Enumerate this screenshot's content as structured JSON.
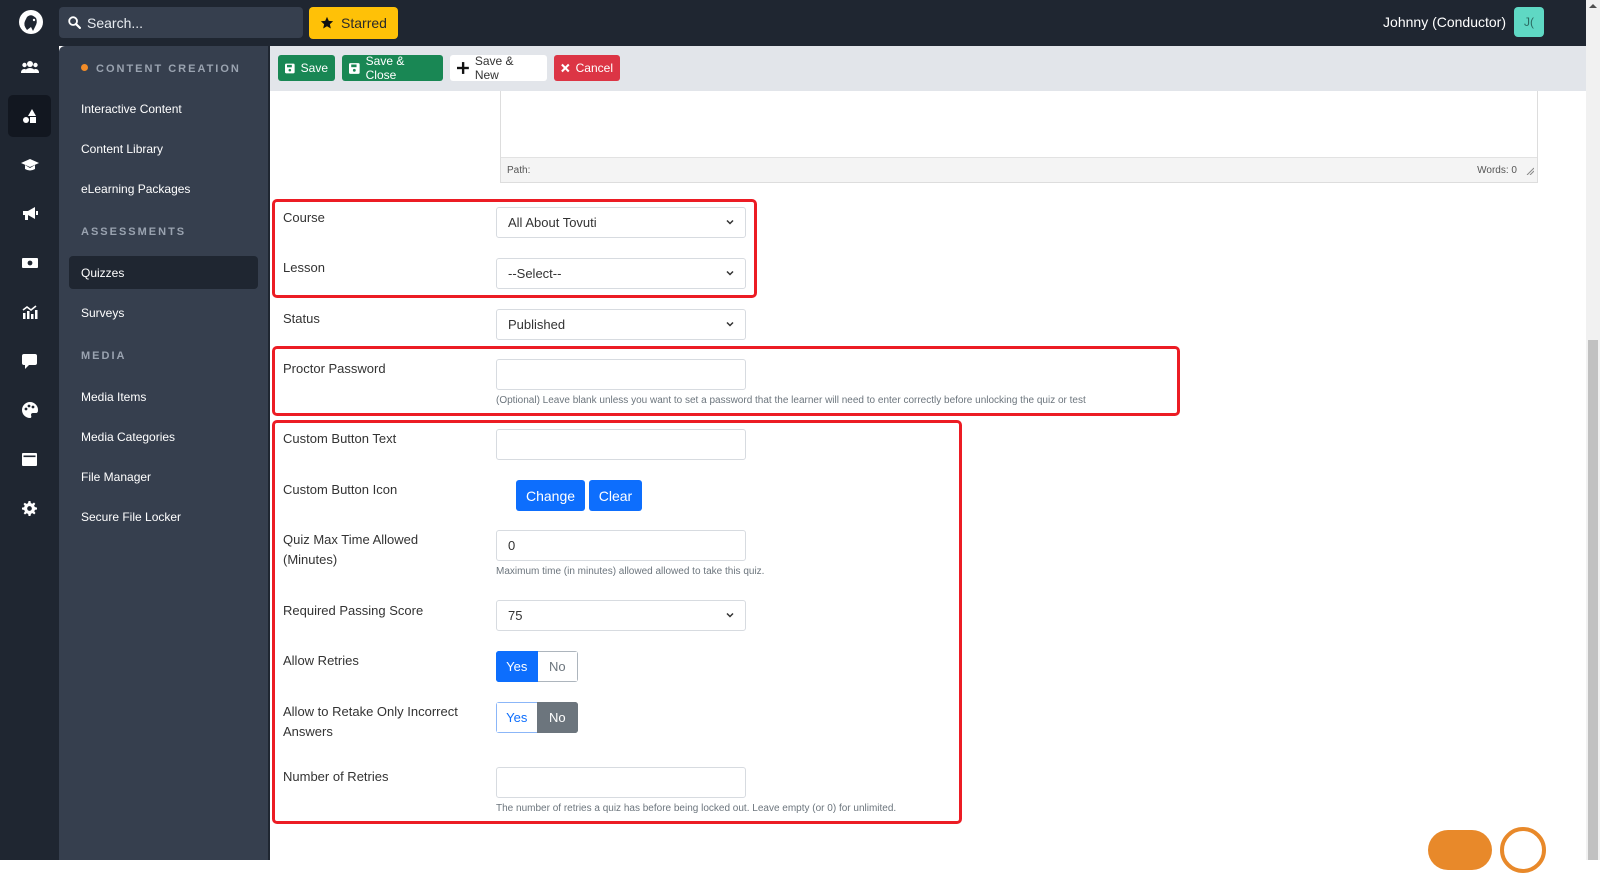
{
  "topbar": {
    "search_placeholder": "Search...",
    "starred_label": "Starred",
    "user_name": "Johnny (Conductor)",
    "avatar_initials": "J("
  },
  "rail": {
    "icons": [
      "users-icon",
      "shapes-icon",
      "graduation-cap-icon",
      "megaphone-icon",
      "money-icon",
      "chart-icon",
      "comment-icon",
      "palette-icon",
      "window-icon",
      "gear-icon"
    ],
    "active_index": 1
  },
  "sidenav": {
    "sections": [
      {
        "heading": "CONTENT CREATION",
        "items": [
          "Interactive Content",
          "Content Library",
          "eLearning Packages"
        ]
      },
      {
        "heading": "ASSESSMENTS",
        "items": [
          "Quizzes",
          "Surveys"
        ]
      },
      {
        "heading": "MEDIA",
        "items": [
          "Media Items",
          "Media Categories",
          "File Manager",
          "Secure File Locker"
        ]
      }
    ],
    "active_item": "Quizzes",
    "accent_color": "#f28c28"
  },
  "toolbar": {
    "save": "Save",
    "save_close": "Save & Close",
    "save_new": "Save & New",
    "cancel": "Cancel"
  },
  "editor": {
    "path_label": "Path:",
    "words_label": "Words: 0"
  },
  "form": {
    "course": {
      "label": "Course",
      "value": "All About Tovuti"
    },
    "lesson": {
      "label": "Lesson",
      "value": "--Select--"
    },
    "status": {
      "label": "Status",
      "value": "Published"
    },
    "proctor_password": {
      "label": "Proctor Password",
      "value": "",
      "help": "(Optional) Leave blank unless you want to set a password that the learner will need to enter correctly before unlocking the quiz or test"
    },
    "custom_button_text": {
      "label": "Custom Button Text",
      "value": ""
    },
    "custom_button_icon": {
      "label": "Custom Button Icon",
      "change": "Change",
      "clear": "Clear"
    },
    "max_time": {
      "label_line1": "Quiz Max Time Allowed",
      "label_line2": "(Minutes)",
      "value": "0",
      "help": "Maximum time (in minutes) allowed allowed to take this quiz."
    },
    "passing_score": {
      "label": "Required Passing Score",
      "value": "75"
    },
    "allow_retries": {
      "label": "Allow Retries",
      "yes": "Yes",
      "no": "No",
      "selected": "Yes"
    },
    "retake_incorrect": {
      "label_line1": "Allow to Retake Only Incorrect",
      "label_line2": "Answers",
      "yes": "Yes",
      "no": "No",
      "selected": "No"
    },
    "number_of_retries": {
      "label": "Number of Retries",
      "value": "",
      "help": "The number of retries a quiz has before being locked out. Leave empty (or 0) for unlimited."
    }
  },
  "colors": {
    "dark": "#1f2631",
    "sidenav": "#363f4e",
    "green": "#198754",
    "red": "#dc3545",
    "blue": "#0d6efd",
    "highlight": "#ec1c24",
    "starred": "#ffc107"
  }
}
